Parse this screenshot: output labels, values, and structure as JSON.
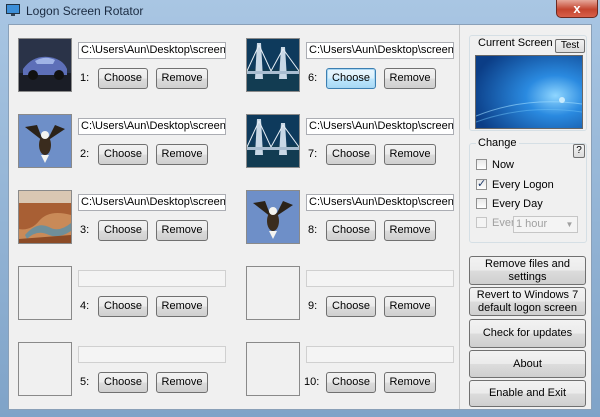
{
  "window": {
    "title": "Logon Screen Rotator",
    "close_label": "x"
  },
  "slots": [
    {
      "number": "1:",
      "path": "C:\\Users\\Aun\\Desktop\\screens\\c",
      "image": "car-wallpaper",
      "choose": "Choose",
      "remove": "Remove"
    },
    {
      "number": "2:",
      "path": "C:\\Users\\Aun\\Desktop\\screens\\e",
      "image": "eagle-wallpaper",
      "choose": "Choose",
      "remove": "Remove"
    },
    {
      "number": "3:",
      "path": "C:\\Users\\Aun\\Desktop\\screens\\r",
      "image": "canyon-wallpaper",
      "choose": "Choose",
      "remove": "Remove"
    },
    {
      "number": "4:",
      "path": "",
      "image": "",
      "choose": "Choose",
      "remove": "Remove"
    },
    {
      "number": "5:",
      "path": "",
      "image": "",
      "choose": "Choose",
      "remove": "Remove"
    },
    {
      "number": "6:",
      "path": "C:\\Users\\Aun\\Desktop\\screens\\b",
      "image": "bridge-wallpaper",
      "choose": "Choose",
      "remove": "Remove"
    },
    {
      "number": "7:",
      "path": "C:\\Users\\Aun\\Desktop\\screens\\b",
      "image": "bridge-wallpaper",
      "choose": "Choose",
      "remove": "Remove"
    },
    {
      "number": "8:",
      "path": "C:\\Users\\Aun\\Desktop\\screens\\e",
      "image": "eagle-wallpaper",
      "choose": "Choose",
      "remove": "Remove"
    },
    {
      "number": "9:",
      "path": "",
      "image": "",
      "choose": "Choose",
      "remove": "Remove"
    },
    {
      "number": "10:",
      "path": "",
      "image": "",
      "choose": "Choose",
      "remove": "Remove"
    }
  ],
  "current_screen": {
    "label": "Current Screen",
    "test_label": "Test"
  },
  "change": {
    "label": "Change",
    "help_label": "?",
    "options": [
      {
        "label": "Now",
        "checked": false,
        "enabled": true
      },
      {
        "label": "Every Logon",
        "checked": true,
        "enabled": true
      },
      {
        "label": "Every Day",
        "checked": false,
        "enabled": true
      },
      {
        "label": "Every",
        "checked": false,
        "enabled": false
      }
    ],
    "interval": "1 hour"
  },
  "actions": {
    "remove_files": "Remove files and settings",
    "revert": "Revert to Windows 7 default logon screen",
    "check_updates": "Check for updates",
    "about": "About",
    "enable_exit": "Enable and Exit"
  },
  "colors": {
    "focus_border": "#3c7fb1",
    "win7_blue": "#1e6fc0"
  }
}
